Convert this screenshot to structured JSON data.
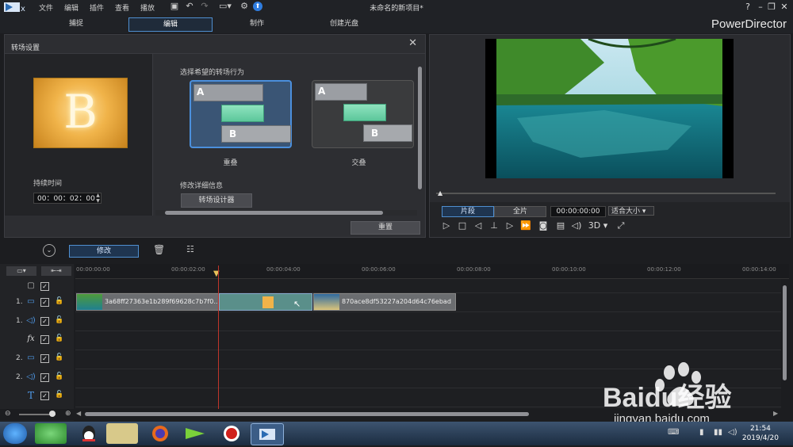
{
  "menu": {
    "items": [
      "文件",
      "编辑",
      "插件",
      "查看",
      "播放"
    ]
  },
  "window": {
    "title": "未命名的新项目*",
    "brand": "PowerDirector"
  },
  "modes": {
    "capture": "捕捉",
    "edit": "编辑",
    "produce": "制作",
    "disc": "创建光盘"
  },
  "transition_panel": {
    "title": "转场设置",
    "duration_label": "持续时间",
    "duration_value": "00：00：02：00",
    "preview_letter": "B",
    "behavior_label": "选择希望的转场行为",
    "cards": {
      "overlap": "重叠",
      "cross": "交叠"
    },
    "a_label": "A",
    "b_label": "B",
    "detail_label": "修改详细信息",
    "designer_button": "转场设计器",
    "reset_button": "重置"
  },
  "viewer": {
    "segment_button": "片段",
    "full_button": "全片",
    "timecode": "00:00:00:00",
    "fit_select": "适合大小",
    "mode_3d": "3D"
  },
  "timeline": {
    "modify_button": "修改",
    "ticks": [
      "00:00:00:00",
      "00:00:02:00",
      "00:00:04:00",
      "00:00:06:00",
      "00:00:08:00",
      "00:00:10:00",
      "00:00:12:00",
      "00:00:14:00"
    ],
    "tracks": [
      {
        "num": "",
        "icon": "master-track-icon"
      },
      {
        "num": "1.",
        "icon": "video-track-icon"
      },
      {
        "num": "1.",
        "icon": "audio-track-icon"
      },
      {
        "num": "",
        "icon": "fx-track-icon"
      },
      {
        "num": "2.",
        "icon": "video-track-icon"
      },
      {
        "num": "2.",
        "icon": "audio-track-icon"
      },
      {
        "num": "",
        "icon": "title-track-icon"
      }
    ],
    "clip1_name": "3a68ff27363e1b289f69628c7b7f0...",
    "clip2_name": "870ace8df53227a204d64c76ebad",
    "fx_symbol": "fx",
    "title_symbol": "T"
  },
  "taskbar": {
    "time": "21:54",
    "date": "2019/4/20"
  },
  "watermark": {
    "text": "Baidu经验",
    "url": "jingyan.baidu.com"
  },
  "colors": {
    "accent": "#4f8fd0",
    "playhead": "#c0352b",
    "transition_green": "#5cc79b"
  }
}
